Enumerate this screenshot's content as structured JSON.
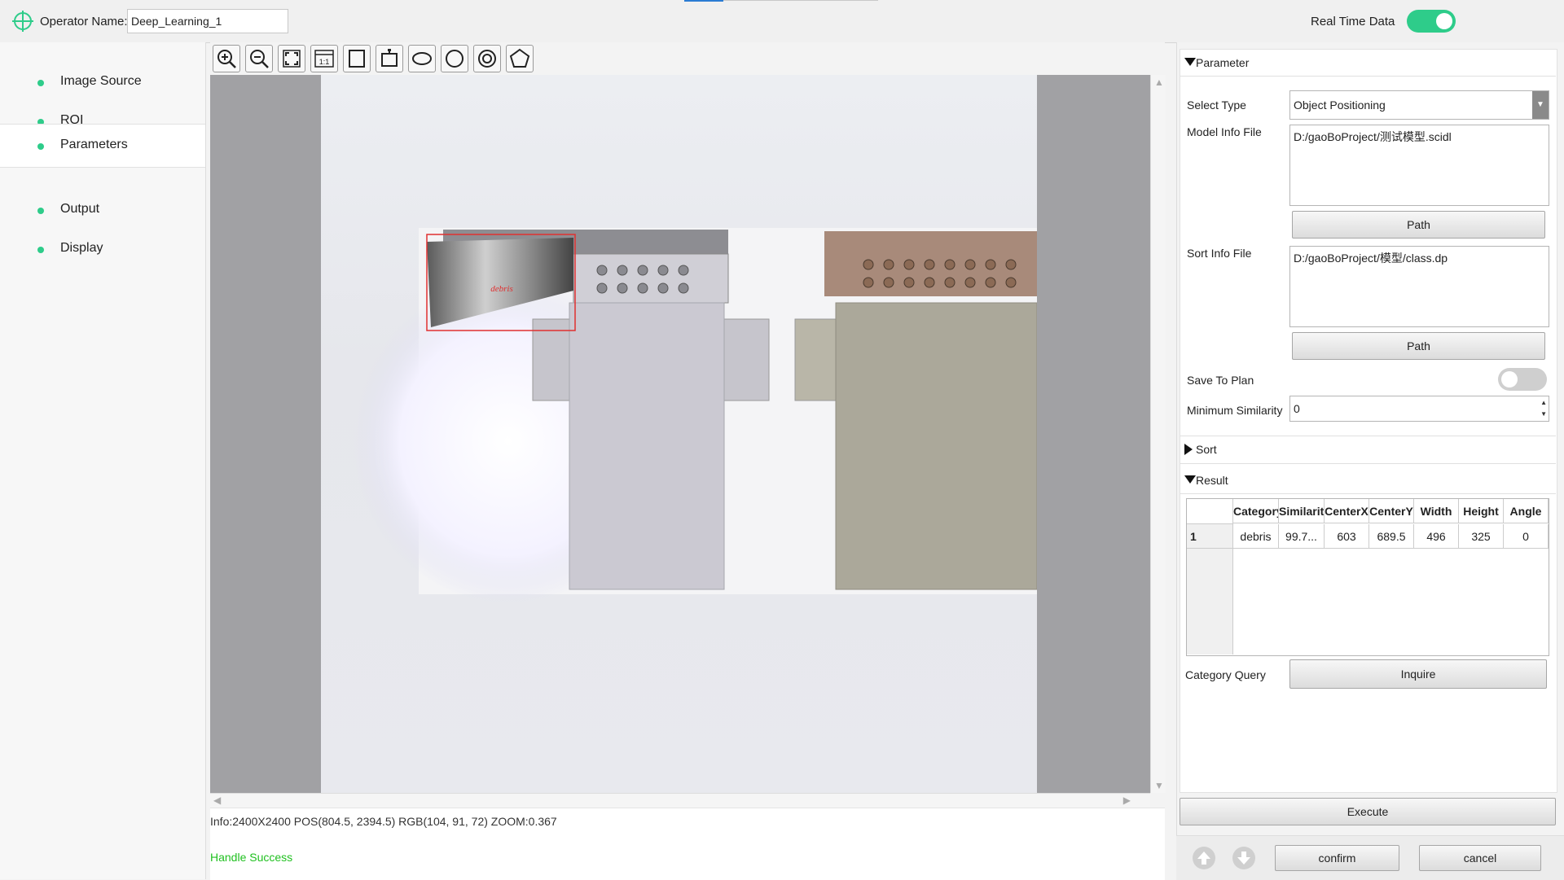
{
  "header": {
    "operator_label": "Operator Name:",
    "operator_value": "Deep_Learning_1",
    "realtime_label": "Real Time Data",
    "realtime_on": true
  },
  "sidebar": {
    "items": [
      {
        "label": "Image Source"
      },
      {
        "label": "ROI"
      },
      {
        "label": "Parameters"
      },
      {
        "label": "Output"
      },
      {
        "label": "Display"
      }
    ],
    "active": "Parameters"
  },
  "toolbar": {
    "tools": [
      "zoom-in-icon",
      "zoom-out-icon",
      "fit-screen-icon",
      "actual-size-icon",
      "rectangle-icon",
      "rotated-rectangle-icon",
      "ellipse-icon",
      "circle-icon",
      "ring-icon",
      "polygon-icon"
    ],
    "actual_size_label": "1:1"
  },
  "canvas": {
    "detection_label": "debris",
    "info": "Info:2400X2400 POS(804.5, 2394.5) RGB(104, 91, 72) ZOOM:0.367",
    "status": "Handle Success"
  },
  "parameter": {
    "section_title": "Parameter",
    "select_type_label": "Select Type",
    "select_type_value": "Object Positioning",
    "model_file_label": "Model Info File",
    "model_file_value": "D:/gaoBoProject/测试模型.scidl",
    "path_label": "Path",
    "sort_file_label": "Sort Info File",
    "sort_file_value": "D:/gaoBoProject/模型/class.dp",
    "save_plan_label": "Save To Plan",
    "save_plan_on": false,
    "min_similarity_label": "Minimum Similarity",
    "min_similarity_value": "0"
  },
  "sort": {
    "section_title": "Sort"
  },
  "result": {
    "section_title": "Result",
    "columns": [
      "Category",
      "Similarity",
      "CenterX",
      "CenterY",
      "Width",
      "Height",
      "Angle"
    ],
    "rows": [
      {
        "index": "1",
        "cells": [
          "debris",
          "99.7...",
          "603",
          "689.5",
          "496",
          "325",
          "0"
        ]
      }
    ],
    "category_query_label": "Category Query",
    "inquire_label": "Inquire"
  },
  "actions": {
    "execute": "Execute",
    "confirm": "confirm",
    "cancel": "cancel"
  },
  "colors": {
    "accent": "#2ecc8a",
    "status_ok": "#20c020",
    "detection_box": "#e03030"
  }
}
